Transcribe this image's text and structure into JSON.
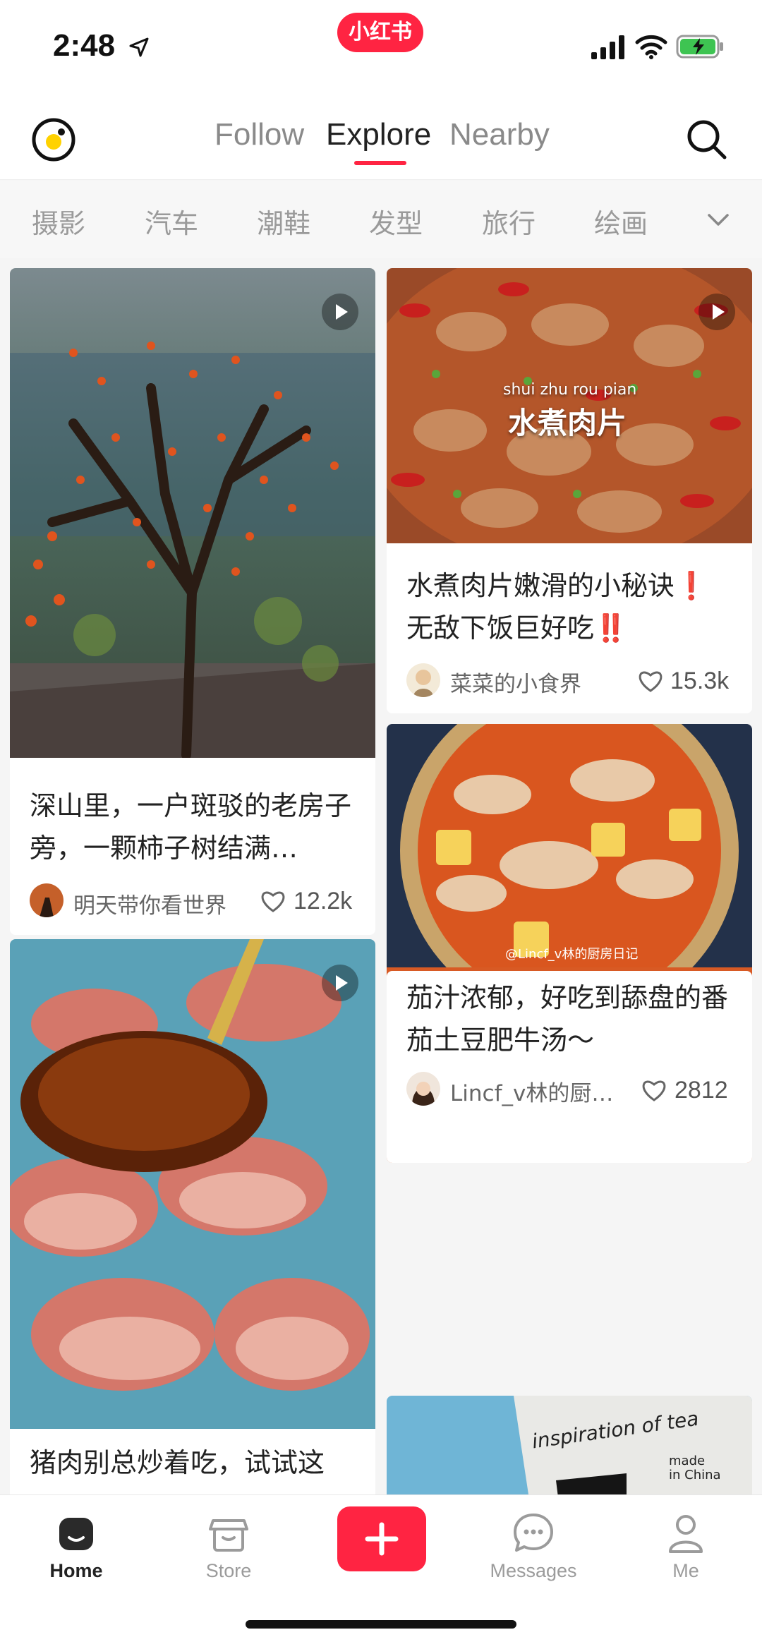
{
  "status_bar": {
    "time": "2:48",
    "app_badge": "小红书"
  },
  "top_nav": {
    "tabs": [
      {
        "label": "Follow",
        "active": false
      },
      {
        "label": "Explore",
        "active": true
      },
      {
        "label": "Nearby",
        "active": false
      }
    ]
  },
  "categories": {
    "items": [
      "摄影",
      "汽车",
      "潮鞋",
      "发型",
      "旅行",
      "绘画"
    ]
  },
  "feed": {
    "posts": [
      {
        "title": "深山里，一户斑驳的老房子旁，一颗柿子树结满…",
        "author": "明天带你看世界",
        "likes": "12.2k",
        "is_video": true
      },
      {
        "overlay_pinyin": "shui zhu rou pian",
        "overlay_title": "水煮肉片",
        "title": "水煮肉片嫩滑的小秘诀❗无敌下饭巨好吃‼️",
        "author": "菜菜的小食界",
        "likes": "15.3k",
        "is_video": true
      },
      {
        "watermark": "@Lincf_v林的厨房日记",
        "title": "茄汁浓郁，好吃到舔盘的番茄土豆肥牛汤～",
        "author": "Lincf_v林的厨…",
        "likes": "2812",
        "is_video": false
      },
      {
        "title": "猪肉别总炒着吃，试试这",
        "is_video": true
      },
      {
        "overlay_text_1": "inspiration of tea",
        "overlay_text_2": "made",
        "overlay_text_3": "in China"
      }
    ]
  },
  "bottom_nav": {
    "items": [
      {
        "label": "Home",
        "icon": "home-icon",
        "active": true
      },
      {
        "label": "Store",
        "icon": "store-icon",
        "active": false
      },
      {
        "label": "Messages",
        "icon": "messages-icon",
        "active": false
      },
      {
        "label": "Me",
        "icon": "me-icon",
        "active": false
      }
    ]
  },
  "colors": {
    "brand": "#ff2442",
    "active_text": "#222222",
    "inactive_text": "#8a8a8a"
  }
}
